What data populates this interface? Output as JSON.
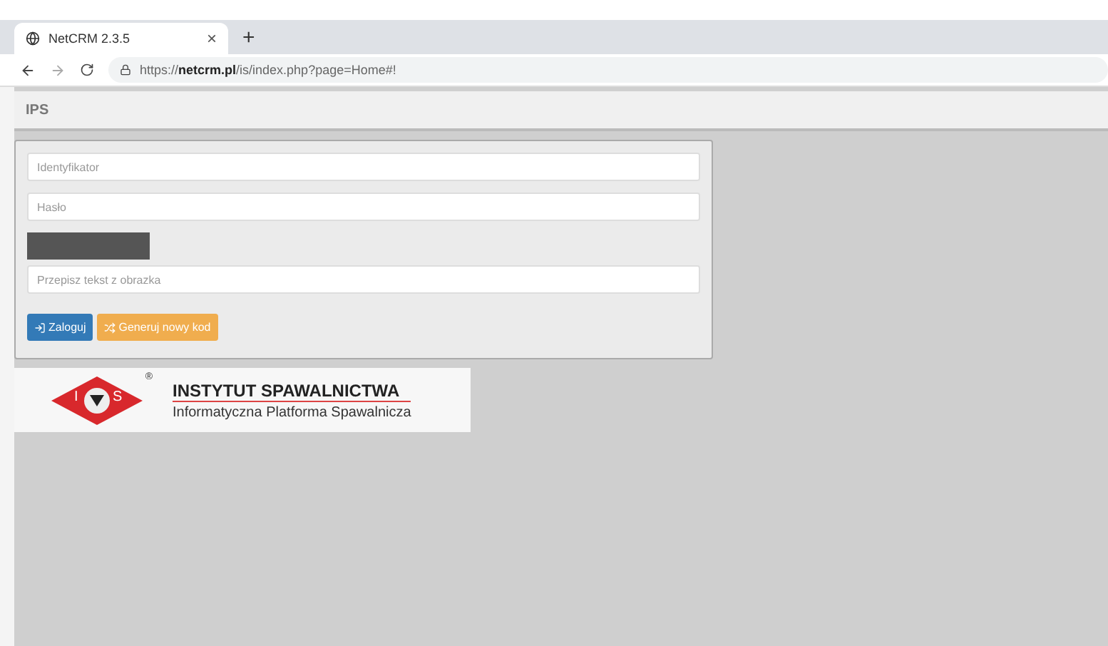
{
  "browser": {
    "tab": {
      "title": "NetCRM 2.3.5",
      "close": "×"
    },
    "new_tab": "+",
    "url": "https://**netcrm.pl**/is/index.php?page=Home#!"
  },
  "header": {
    "title": "IPS"
  },
  "login": {
    "fields": [
      {
        "placeholder": "Identyfikator"
      },
      {
        "placeholder": "Hasło"
      },
      {
        "placeholder": "Przepisz tekst z obrazka"
      }
    ],
    "buttons": [
      {
        "label": "Zaloguj",
        "kind": "primary"
      },
      {
        "label": "Generuj nowy kod",
        "kind": "warning"
      }
    ]
  },
  "logo": {
    "left_letter": "I",
    "right_letter": "S",
    "registered": "®",
    "title": "INSTYTUT SPAWALNICTWA",
    "subtitle": "Informatyczna Platforma Spawalnicza"
  }
}
